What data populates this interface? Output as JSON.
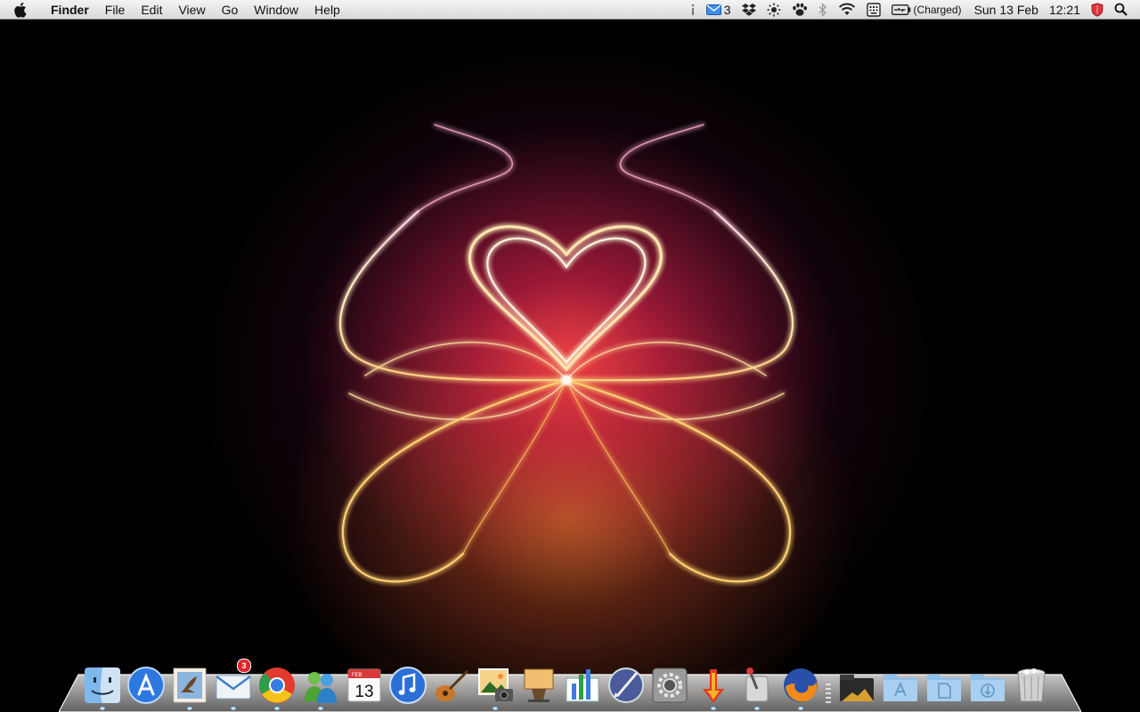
{
  "menubar": {
    "app_name": "Finder",
    "menus": [
      "File",
      "Edit",
      "View",
      "Go",
      "Window",
      "Help"
    ],
    "status": {
      "mail_count": "3",
      "battery_text": "(Charged)",
      "date": "Sun 13 Feb",
      "time": "12:21"
    }
  },
  "dock": {
    "mail_badge": "3",
    "calendar_month": "FEB",
    "calendar_day": "13"
  },
  "colors": {
    "accent": "#3f8ee8",
    "badge": "#e0262b",
    "wallpaper_glow": "#ff4a5a"
  }
}
